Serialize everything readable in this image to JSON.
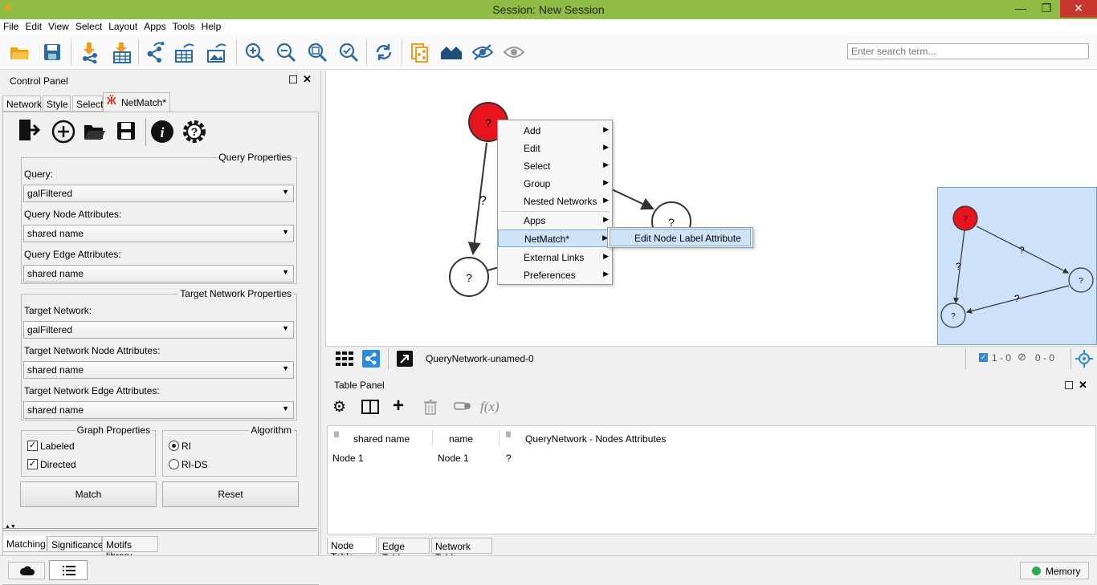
{
  "window": {
    "title": "Session: New Session",
    "minimize": "—",
    "restore": "❐",
    "close": "✕"
  },
  "menu": [
    "File",
    "Edit",
    "View",
    "Select",
    "Layout",
    "Apps",
    "Tools",
    "Help"
  ],
  "search": {
    "placeholder": "Enter search term..."
  },
  "control_panel": {
    "title": "Control Panel",
    "tabs": [
      "Network",
      "Style",
      "Select",
      "NetMatch*"
    ],
    "query_properties": {
      "title": "Query Properties",
      "query_label": "Query:",
      "query_value": "galFiltered",
      "node_attr_label": "Query Node Attributes:",
      "node_attr_value": "shared name",
      "edge_attr_label": "Query Edge Attributes:",
      "edge_attr_value": "shared name"
    },
    "target_properties": {
      "title": "Target Network Properties",
      "network_label": "Target Network:",
      "network_value": "galFiltered",
      "node_attr_label": "Target Network Node Attributes:",
      "node_attr_value": "shared name",
      "edge_attr_label": "Target Network Edge Attributes:",
      "edge_attr_value": "shared name"
    },
    "graph_properties": {
      "title": "Graph Properties",
      "labeled": "Labeled",
      "directed": "Directed",
      "labeled_checked": true,
      "directed_checked": true
    },
    "algorithm": {
      "title": "Algorithm",
      "ri": "RI",
      "rids": "RI-DS",
      "selected": "RI"
    },
    "match_button": "Match",
    "reset_button": "Reset",
    "bottom_tabs": [
      "Matching",
      "Significance",
      "Motifs library"
    ]
  },
  "network": {
    "node_label": "?",
    "edge_label": "?",
    "network_name": "QueryNetwork-unamed-0",
    "selection_count": "1 - 0",
    "hidden_count": "0 - 0"
  },
  "context_menu": {
    "items": [
      "Add",
      "Edit",
      "Select",
      "Group",
      "Nested Networks",
      "Apps",
      "NetMatch*",
      "External Links",
      "Preferences"
    ],
    "highlighted": "NetMatch*",
    "submenu": [
      "Edit Node Label Attribute"
    ]
  },
  "table_panel": {
    "title": "Table Panel",
    "columns": [
      "shared name",
      "name",
      "QueryNetwork - Nodes Attributes"
    ],
    "rows": [
      [
        "Node 1",
        "Node 1",
        "?"
      ]
    ],
    "tabs": [
      "Node Table",
      "Edge Table",
      "Network Table"
    ],
    "fx": "f(x)"
  },
  "status": {
    "memory": "Memory",
    "memory_color": "#2fa84f"
  },
  "colors": {
    "titlebar": "#8fbc45",
    "selected_node": "#e8141e",
    "minimap_bg": "#cce2fa",
    "menu_highlight": "#cfe3f7"
  }
}
